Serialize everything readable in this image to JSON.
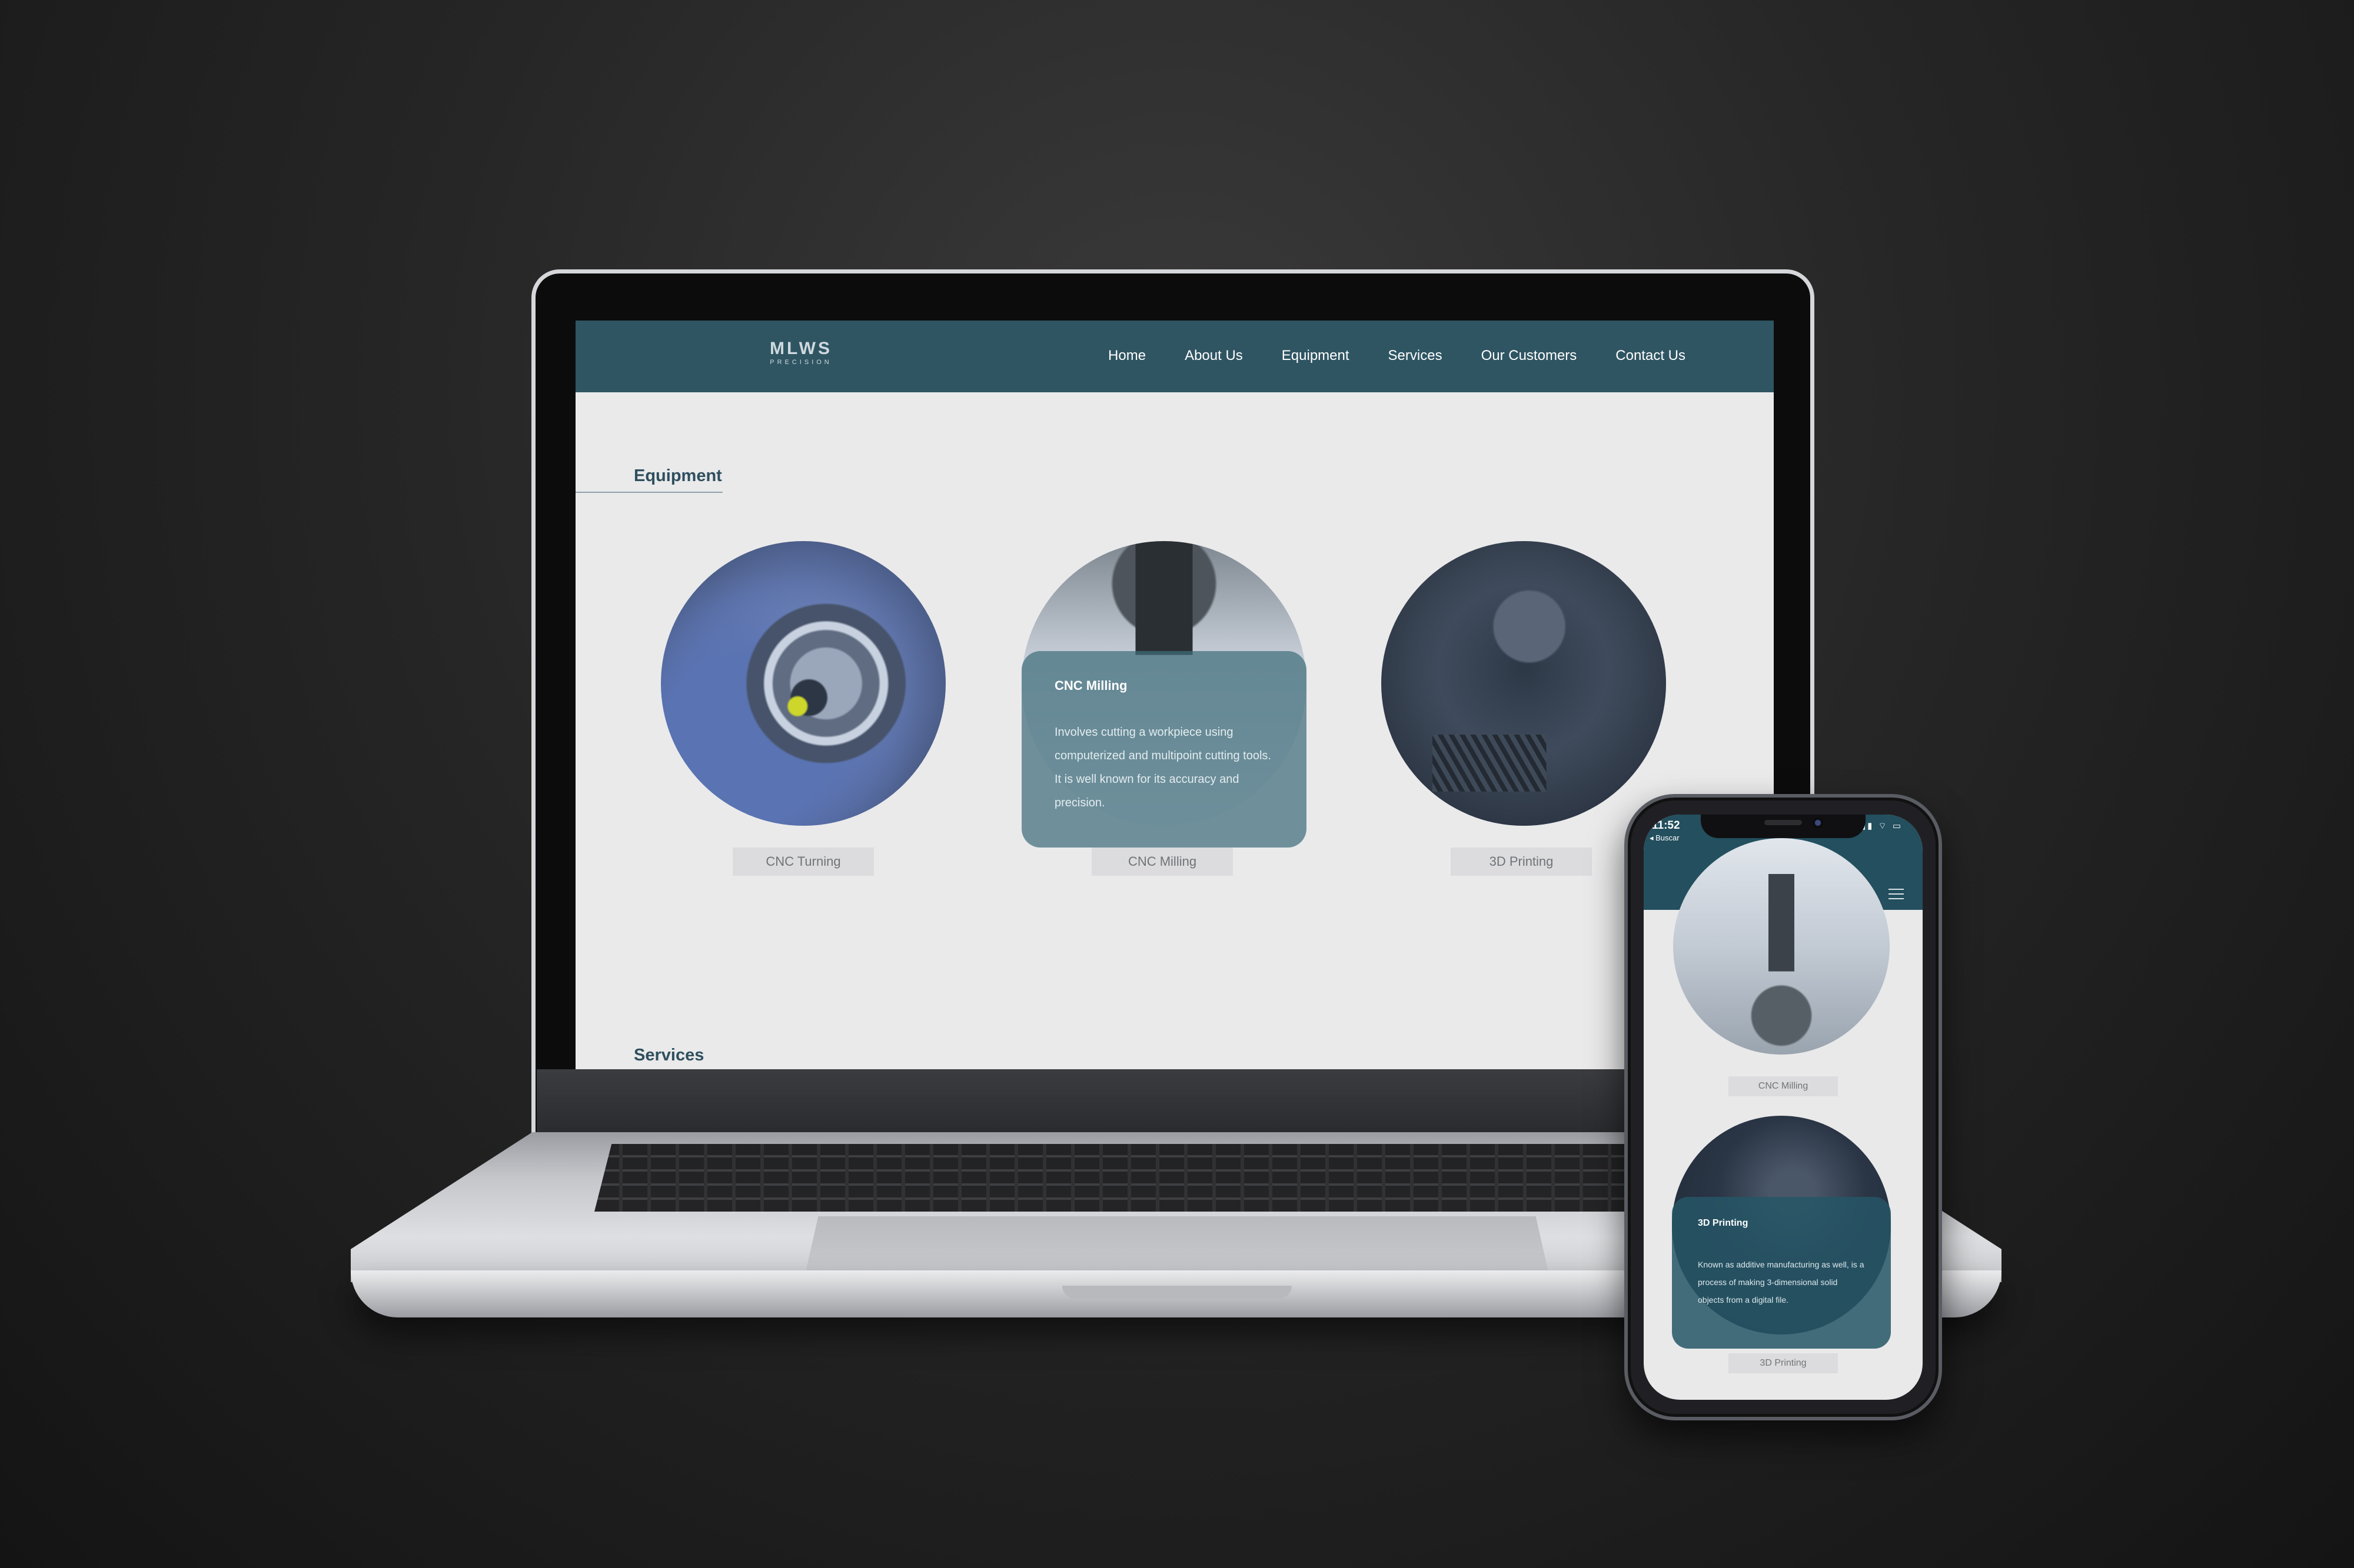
{
  "site": {
    "logo": {
      "main": "MLWS",
      "sub": "PRECISION"
    },
    "nav": [
      "Home",
      "About Us",
      "Equipment",
      "Services",
      "Our Customers",
      "Contact Us"
    ]
  },
  "desktop": {
    "equipment_title": "Equipment",
    "services_title": "Services",
    "items": [
      {
        "caption": "CNC Turning"
      },
      {
        "caption": "CNC Milling",
        "card_title": "CNC Milling",
        "card_text": "Involves cutting a workpiece using computerized and multipoint cutting tools. It is well known for its accuracy and precision."
      },
      {
        "caption": "3D Printing"
      }
    ]
  },
  "mobile": {
    "status": {
      "time": "11:52",
      "back_label": "◂ Buscar",
      "icons": "▮▮▮ ⌔ ▭"
    },
    "items": [
      {
        "caption": "CNC Milling"
      },
      {
        "caption": "3D Printing",
        "card_title": "3D Printing",
        "card_text": "Known as additive manufacturing as well, is a process of making 3-dimensional solid objects from a digital file."
      }
    ]
  },
  "colors": {
    "header": "#2f5563",
    "mobile_header": "#234f5e",
    "page_bg": "#eaeaeb",
    "title": "#2f4f5e"
  }
}
